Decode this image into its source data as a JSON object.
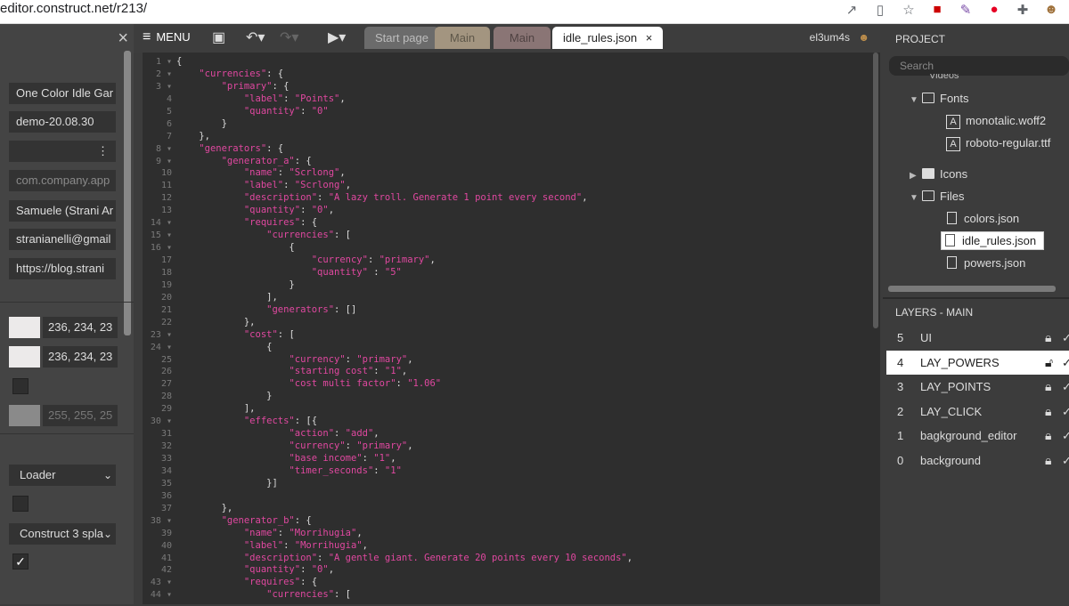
{
  "browser": {
    "url": "editor.construct.net/r213/",
    "icons": [
      "external-link-icon",
      "page-icon",
      "star-icon",
      "extension-icon",
      "eyedropper-icon",
      "pinterest-icon",
      "puzzle-icon",
      "profile-icon"
    ]
  },
  "left_panel": {
    "close_label": "×",
    "fields": [
      {
        "value": "One Color Idle Gar",
        "dim": false
      },
      {
        "value": "demo-20.08.30",
        "dim": false
      },
      {
        "value": "",
        "dim": false
      },
      {
        "value": "com.company.app",
        "dim": true
      },
      {
        "value": "Samuele (Strani Ar",
        "dim": false
      },
      {
        "value": "stranianelli@gmail",
        "dim": false
      },
      {
        "value": "https://blog.strani",
        "dim": false
      }
    ],
    "kebab": "⋮",
    "colors": [
      {
        "swatch": "#ecead f",
        "text": "236, 234, 23"
      },
      {
        "swatch": "#eceaea",
        "text": "236, 234, 23"
      },
      {
        "swatch": "#8a8a8a",
        "text": "255, 255, 25"
      }
    ],
    "loader_select": "Loader",
    "splash_select": "Construct 3 spla",
    "check_mark": "✓"
  },
  "toolbar": {
    "menu_label": "MENU",
    "tabs": [
      {
        "label": "Start page",
        "bg": "#6b6b6b",
        "color": "#bdbdbd"
      },
      {
        "label": "Main",
        "bg": "#a39580",
        "color": "#5e5749"
      },
      {
        "label": "Main",
        "bg": "#8a7575",
        "color": "#4f4242"
      },
      {
        "label": "idle_rules.json",
        "bg": "#ffffff",
        "color": "#222222"
      }
    ],
    "tab_close": "×",
    "username": "el3um4s"
  },
  "editor": {
    "line_numbers": [
      "1 ▾",
      "2 ▾",
      "3 ▾",
      "4",
      "5",
      "6",
      "7",
      "8 ▾",
      "9 ▾",
      "10",
      "11",
      "12",
      "13",
      "14 ▾",
      "15 ▾",
      "16 ▾",
      "17",
      "18",
      "19",
      "20",
      "21",
      "22",
      "23 ▾",
      "24 ▾",
      "25",
      "26",
      "27",
      "28",
      "29",
      "30 ▾",
      "31",
      "32",
      "33",
      "34",
      "35",
      "36",
      "37",
      "38 ▾",
      "39",
      "40",
      "41",
      "42",
      "43 ▾",
      "44 ▾"
    ],
    "lines": [
      "{",
      "    \"currencies\": {",
      "        \"primary\": {",
      "            \"label\": \"Points\",",
      "            \"quantity\": \"0\"",
      "        }",
      "    },",
      "    \"generators\": {",
      "        \"generator_a\": {",
      "            \"name\": \"Scrlong\",",
      "            \"label\": \"Scrlong\",",
      "            \"description\": \"A lazy troll. Generate 1 point every second\",",
      "            \"quantity\": \"0\",",
      "            \"requires\": {",
      "                \"currencies\": [",
      "                    {",
      "                        \"currency\": \"primary\",",
      "                        \"quantity\" : \"5\"",
      "                    }",
      "                ],",
      "                \"generators\": []",
      "            },",
      "            \"cost\": [",
      "                {",
      "                    \"currency\": \"primary\",",
      "                    \"starting cost\": \"1\",",
      "                    \"cost multi factor\": \"1.06\"",
      "                }",
      "            ],",
      "            \"effects\": [{",
      "                    \"action\": \"add\",",
      "                    \"currency\": \"primary\",",
      "                    \"base income\": \"1\",",
      "                    \"timer_seconds\": \"1\"",
      "                }]",
      "",
      "        },",
      "        \"generator_b\": {",
      "            \"name\": \"Morrihugia\",",
      "            \"label\": \"Morrihugia\",",
      "            \"description\": \"A gentle giant. Generate 20 points every 10 seconds\",",
      "            \"quantity\": \"0\",",
      "            \"requires\": {",
      "                \"currencies\": ["
    ]
  },
  "project": {
    "title": "PROJECT",
    "search_placeholder": "Search",
    "partial_item": "Videos",
    "items": [
      {
        "label": "Fonts",
        "type": "folder",
        "expanded": true,
        "depth": 1
      },
      {
        "label": "monotalic.woff2",
        "type": "font",
        "depth": 2
      },
      {
        "label": "roboto-regular.ttf",
        "type": "font",
        "depth": 2
      },
      {
        "label": "Icons",
        "type": "folder",
        "expanded": false,
        "depth": 1
      },
      {
        "label": "Files",
        "type": "folder",
        "expanded": true,
        "depth": 1
      },
      {
        "label": "colors.json",
        "type": "file",
        "depth": 2
      },
      {
        "label": "idle_rules.json",
        "type": "file",
        "depth": 2,
        "selected": true
      },
      {
        "label": "powers.json",
        "type": "file",
        "depth": 2
      }
    ]
  },
  "layers": {
    "title": "LAYERS - MAIN",
    "rows": [
      {
        "num": "5",
        "name": "UI",
        "active": false
      },
      {
        "num": "4",
        "name": "LAY_POWERS",
        "active": true
      },
      {
        "num": "3",
        "name": "LAY_POINTS",
        "active": false
      },
      {
        "num": "2",
        "name": "LAY_CLICK",
        "active": false
      },
      {
        "num": "1",
        "name": "bagkground_editor",
        "active": false
      },
      {
        "num": "0",
        "name": "background",
        "active": false
      }
    ]
  }
}
